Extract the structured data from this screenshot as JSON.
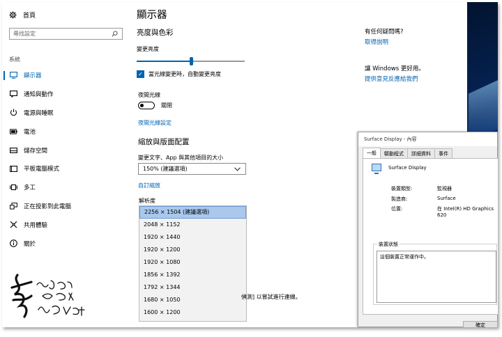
{
  "sidebar": {
    "home_label": "首頁",
    "search_placeholder": "尋找設定",
    "section_label": "系統",
    "items": [
      {
        "label": "顯示器",
        "icon": "display-icon"
      },
      {
        "label": "通知與動作",
        "icon": "notification-icon"
      },
      {
        "label": "電源與睡眠",
        "icon": "power-icon"
      },
      {
        "label": "電池",
        "icon": "battery-icon"
      },
      {
        "label": "儲存空間",
        "icon": "storage-icon"
      },
      {
        "label": "平板電腦模式",
        "icon": "tablet-icon"
      },
      {
        "label": "多工",
        "icon": "multitask-icon"
      },
      {
        "label": "正在投影到此電腦",
        "icon": "project-icon"
      },
      {
        "label": "共用體驗",
        "icon": "shared-icon"
      },
      {
        "label": "關於",
        "icon": "info-icon"
      }
    ]
  },
  "main": {
    "title": "顯示器",
    "brightness_heading": "亮度與色彩",
    "brightness_label": "變更亮度",
    "brightness_level": 0.5,
    "auto_brightness_label": "當光線變更時，自動變更亮度",
    "auto_brightness_checked": true,
    "night_light_label": "夜間光線",
    "night_light_state": "關閉",
    "night_light_link": "夜間光線設定",
    "scale_heading": "縮放與版面配置",
    "scale_label": "變更文字、App 與其他項目的大小",
    "scale_value": "150% (建議選項)",
    "custom_scale_link": "自訂縮放",
    "resolution_label": "解析度",
    "resolution_options": [
      "2256 × 1504 (建議選項)",
      "2048 × 1152",
      "1920 × 1440",
      "1920 × 1200",
      "1920 × 1080",
      "1856 × 1392",
      "1792 × 1344",
      "1680 × 1050",
      "1600 × 1200"
    ],
    "resolution_selected_index": 0,
    "tail_text": "偵測] 以嘗試進行連線。"
  },
  "help": {
    "question": "有任何疑問嗎?",
    "question_link": "取得說明",
    "improve": "讓 Windows 更好用。",
    "improve_link": "提供意見反應給我們"
  },
  "dialog": {
    "title": "Surface Display - 內容",
    "tabs": [
      "一般",
      "驅動程式",
      "詳細資料",
      "事件"
    ],
    "device_name": "Surface Display",
    "props": [
      {
        "key": "裝置類型:",
        "value": "監視器"
      },
      {
        "key": "製造商:",
        "value": "Surface"
      },
      {
        "key": "位置:",
        "value": "在 Intel(R) HD Graphics 620"
      }
    ],
    "status_title": "裝置狀態",
    "status_text": "這個裝置正常運作中。",
    "ok_label": "確定"
  },
  "colors": {
    "accent": "#0063b1",
    "selection": "#a9c8ec"
  }
}
